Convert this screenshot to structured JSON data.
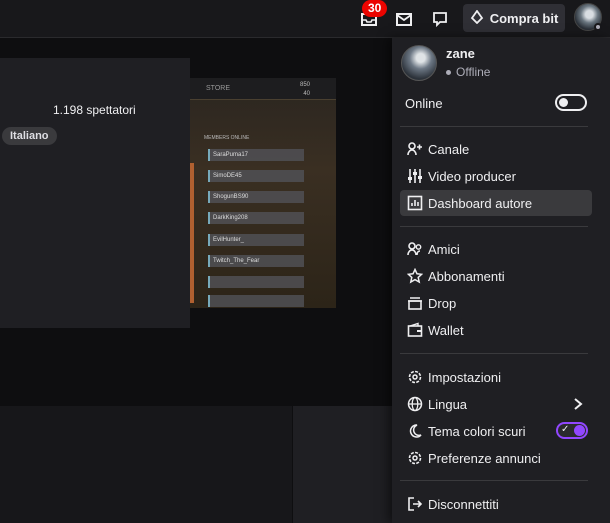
{
  "topbar": {
    "notifications_count": "30",
    "bits_label": "Compra bit",
    "icons": [
      "notifications-icon",
      "inbox-icon",
      "whispers-icon",
      "bits-icon"
    ]
  },
  "stream_card": {
    "viewers": "1.198 spettatori",
    "tag": "Italiano"
  },
  "thumbnail": {
    "store": "STORE",
    "stat1": "850",
    "stat2": "40",
    "members": "MEMBERS ONLINE",
    "rows": [
      "SaraPuma17",
      "SimoDE45",
      "ShogunBS90",
      "DarkKing208",
      "EvilHunter_",
      "Twitch_The_Fear",
      "",
      ""
    ]
  },
  "menu": {
    "username": "zane",
    "status": "Offline",
    "online_label": "Online",
    "online_on": false,
    "group1": [
      {
        "label": "Canale",
        "icon": "channel-icon"
      },
      {
        "label": "Video producer",
        "icon": "sliders-icon"
      },
      {
        "label": "Dashboard autore",
        "icon": "dashboard-icon"
      }
    ],
    "group2": [
      {
        "label": "Amici",
        "icon": "friends-icon"
      },
      {
        "label": "Abbonamenti",
        "icon": "star-icon"
      },
      {
        "label": "Drop",
        "icon": "gift-icon"
      },
      {
        "label": "Wallet",
        "icon": "wallet-icon"
      }
    ],
    "group3": [
      {
        "label": "Impostazioni",
        "icon": "gear-icon"
      },
      {
        "label": "Lingua",
        "icon": "globe-icon"
      },
      {
        "label": "Tema colori scuri",
        "icon": "moon-icon"
      },
      {
        "label": "Preferenze annunci",
        "icon": "gear-icon"
      }
    ],
    "dark_theme_on": true,
    "logout_label": "Disconnettiti",
    "accent": "#9147ff"
  }
}
